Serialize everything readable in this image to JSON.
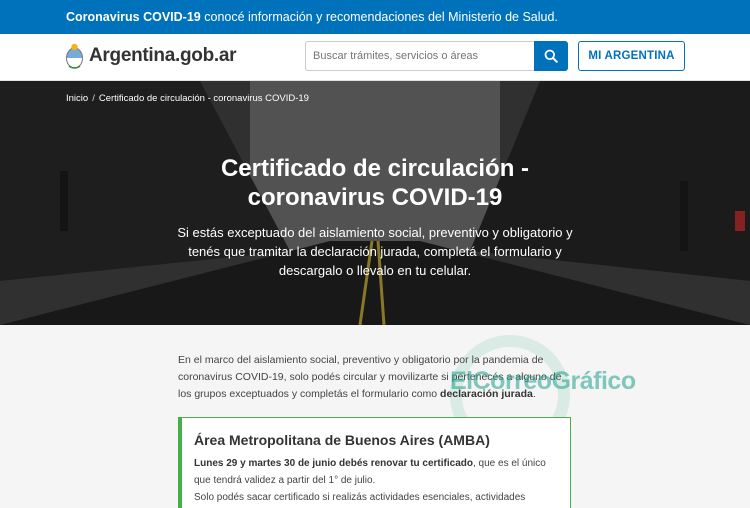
{
  "alert": {
    "strong": "Coronavirus COVID-19",
    "text": " conocé información y recomendaciones del Ministerio de Salud."
  },
  "header": {
    "logo_text": "Argentina.gob.ar",
    "search_placeholder": "Buscar trámites, servicios o áreas",
    "mi_argentina": "MI ARGENTINA"
  },
  "breadcrumb": {
    "home": "Inicio",
    "separator": "/",
    "current": "Certificado de circulación - coronavirus COVID-19"
  },
  "hero": {
    "title_line1": "Certificado de circulación -",
    "title_line2": "coronavirus COVID-19",
    "subtitle": "Si estás exceptuado del aislamiento social, preventivo y obligatorio y tenés que tramitar la declaración jurada, completá el formulario y descargalo o llevalo en tu celular."
  },
  "intro": {
    "text": "En el marco del aislamiento social, preventivo y obligatorio por la pandemia de coronavirus COVID-19, solo podés circular y movilizarte si pertenecés a alguno de los grupos exceptuados y completás el formulario como ",
    "strong": "declaración jurada",
    "end": "."
  },
  "watermark": "ElCorreoGráfico",
  "amba": {
    "title": "Área Metropolitana de Buenos Aires (AMBA)",
    "strong": "Lunes 29 y martes 30 de junio debés renovar tu certificado",
    "text1": ", que es el único que tendrá validez a partir del 1° de julio.",
    "text2": "Solo podés sacar certificado si realizás actividades esenciales, actividades"
  },
  "colors": {
    "primary": "#0072bb",
    "amba_border": "#46ae4a"
  }
}
